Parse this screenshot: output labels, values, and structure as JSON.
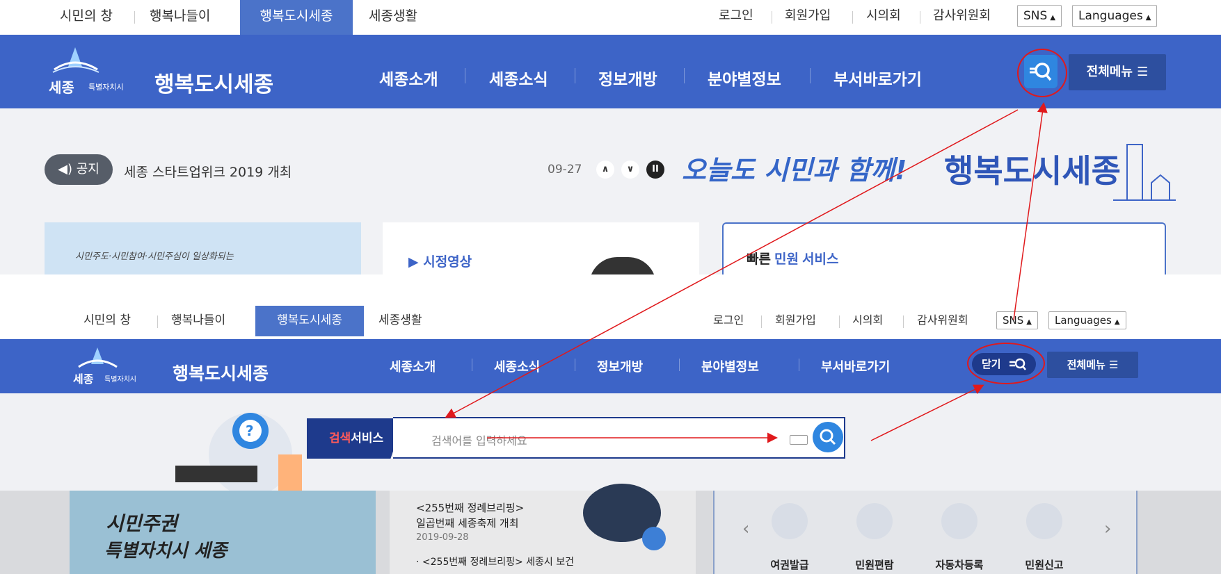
{
  "panel1": {
    "util": {
      "tabs": [
        "시민의 창",
        "행복나들이",
        "행복도시세종",
        "세종생활"
      ],
      "right_links": [
        "로그인",
        "회원가입",
        "시의회",
        "감사위원회"
      ],
      "sns_label": "SNS",
      "lang_label": "Languages"
    },
    "header": {
      "logo_name": "세종",
      "logo_sub": "특별자치시",
      "logo_main": "행복도시세종",
      "nav": [
        "세종소개",
        "세종소식",
        "정보개방",
        "분야별정보",
        "부서바로가기"
      ],
      "fullmenu": "전체메뉴 ☰"
    },
    "notice": {
      "badge": "◀) 공지",
      "text": "세종 스타트업위크 2019 개최",
      "date": "09-27"
    },
    "slogan_a": "오늘도 시민과 함께!",
    "slogan_b": "행복도시세종",
    "banner_text": "시민주도·시민참여·시민주심이 일상화되는",
    "card_video_title": "▶ 시정영상",
    "card_service_title_a": "빠른",
    "card_service_title_b": "민원",
    "card_service_title_c": "서비스"
  },
  "panel2": {
    "util": {
      "tabs": [
        "시민의 창",
        "행복나들이",
        "행복도시세종",
        "세종생활"
      ],
      "right_links": [
        "로그인",
        "회원가입",
        "시의회",
        "감사위원회"
      ],
      "sns_label": "SNS",
      "lang_label": "Languages"
    },
    "header": {
      "logo_name": "세종",
      "logo_sub": "특별자치시",
      "logo_main": "행복도시세종",
      "nav": [
        "세종소개",
        "세종소식",
        "정보개방",
        "분야별정보",
        "부서바로가기"
      ],
      "close_label": "닫기",
      "fullmenu": "전체메뉴 ☰"
    },
    "search": {
      "label_a": "검색",
      "label_b": "서비스",
      "placeholder": "검색어를 입력하세요"
    },
    "video_items": [
      "<255번째 정례브리핑>",
      "일곱번째 세종축제 개최",
      "2019-09-28",
      "· <255번째 정례브리핑> 세종시 보건"
    ],
    "banner_a": "시민주권",
    "banner_b": "특별자치시 세종",
    "services": [
      "여권발급",
      "민원편람",
      "자동차등록",
      "민원신고"
    ]
  },
  "colors": {
    "header_blue": "#3d64c7",
    "accent_red": "#e0191c",
    "search_navy": "#1e3a8c"
  }
}
